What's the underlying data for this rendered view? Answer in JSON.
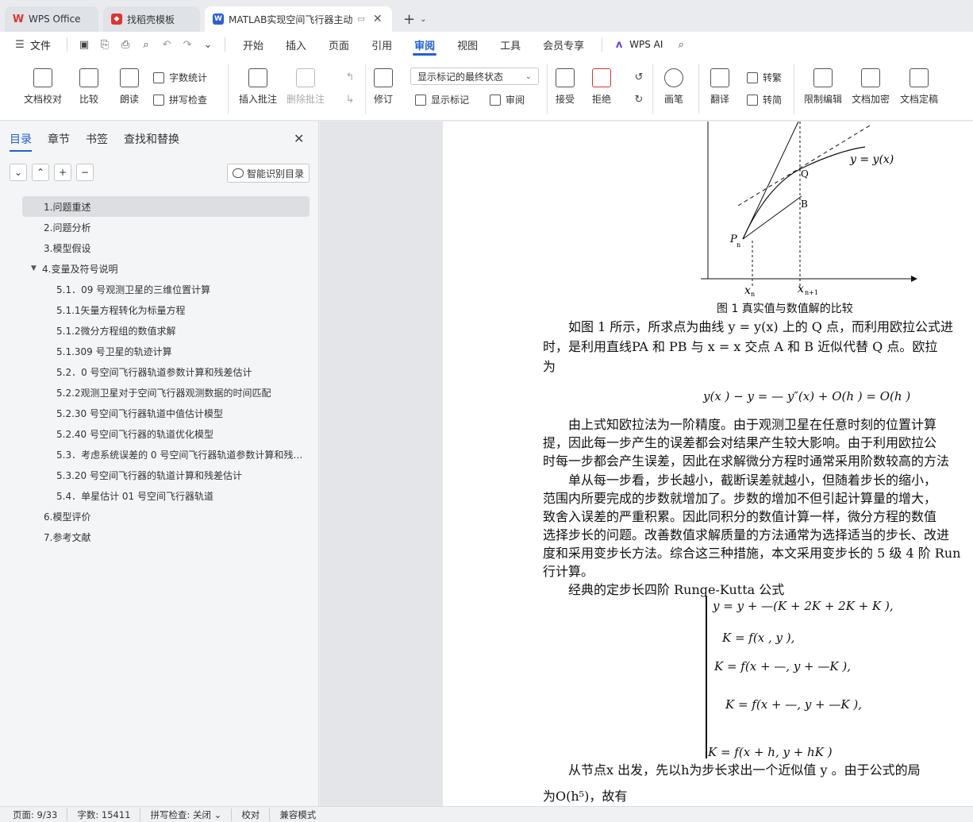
{
  "tabs": [
    {
      "label": "WPS Office",
      "icon": "wps-logo-icon"
    },
    {
      "label": "找稻壳模板",
      "icon": "docer-icon"
    },
    {
      "label": "MATLAB实现空间飞行器主动",
      "icon": "writer-icon",
      "active": true
    }
  ],
  "menu": {
    "file": "文件",
    "items": [
      "开始",
      "插入",
      "页面",
      "引用",
      "审阅",
      "视图",
      "工具",
      "会员专享"
    ],
    "active": "审阅",
    "ai": "WPS AI"
  },
  "ribbon": {
    "doc_check": "文档校对",
    "compare": "比较",
    "read_aloud": "朗读",
    "word_count": "字数统计",
    "spell_check": "拼写检查",
    "insert_comment": "插入批注",
    "delete_comment": "删除批注",
    "revise": "修订",
    "show_mode": "显示标记的最终状态",
    "show_marks": "显示标记",
    "review": "审阅",
    "accept": "接受",
    "reject": "拒绝",
    "pen": "画笔",
    "translate": "翻译",
    "to_traditional": "转繁",
    "to_simplified": "转简",
    "restrict_edit": "限制编辑",
    "encrypt": "文档加密",
    "finalize": "文档定稿"
  },
  "left_panel": {
    "tabs": [
      "目录",
      "章节",
      "书签",
      "查找和替换"
    ],
    "active_tab": "目录",
    "smart_toc": "智能识别目录",
    "toc": [
      {
        "label": "1.问题重述",
        "level": 1,
        "selected": true
      },
      {
        "label": "2.问题分析",
        "level": 1
      },
      {
        "label": "3.模型假设",
        "level": 1
      },
      {
        "label": "4.变量及符号说明",
        "level": 1,
        "expanded": true
      },
      {
        "label": "5.1．09 号观测卫星的三维位置计算",
        "level": 2
      },
      {
        "label": "5.1.1矢量方程转化为标量方程",
        "level": 2
      },
      {
        "label": "5.1.2微分方程组的数值求解",
        "level": 2
      },
      {
        "label": "5.1.309 号卫星的轨迹计算",
        "level": 2
      },
      {
        "label": "5.2．0 号空间飞行器轨道参数计算和残差估计",
        "level": 2
      },
      {
        "label": "5.2.2观测卫星对于空间飞行器观测数据的时间匹配",
        "level": 2
      },
      {
        "label": "5.2.30 号空间飞行器轨道中值估计模型",
        "level": 2
      },
      {
        "label": "5.2.40 号空间飞行器的轨道优化模型",
        "level": 2
      },
      {
        "label": "5.3．考虑系统误差的 0 号空间飞行器轨道参数计算和残差估计",
        "level": 2
      },
      {
        "label": "5.3.20 号空间飞行器的轨道计算和残差估计",
        "level": 2
      },
      {
        "label": "5.4．单星估计 01 号空间飞行器轨道",
        "level": 2
      },
      {
        "label": "6.模型评价",
        "level": 1
      },
      {
        "label": "7.参考文献",
        "level": 1
      }
    ]
  },
  "document": {
    "figure": {
      "curve_label": "y = y(x)",
      "point_q": "Q",
      "point_b": "B",
      "point_p": "P",
      "point_p_sub": "n",
      "x_n": "x",
      "x_n_sub": "n",
      "x_n1": "x",
      "x_n1_sub": "n+1",
      "caption": "图 1 真实值与数值解的比较"
    },
    "para1_line1": "如图 1 所示，所求点为曲线  y = y(x) 上的 Q 点，而利用欧拉公式进",
    "para1_line2": "时，是利用直线PA 和 PB 与 x = x  交点 A 和 B 近似代替 Q 点。欧拉",
    "para1_line3": "为",
    "formula_error": "y(x   ) − y    =  — y″(x) + O(h ) = O(h )",
    "para2_line1": "由上式知欧拉法为一阶精度。由于观测卫星在任意时刻的位置计算",
    "para2_line2": "提，因此每一步产生的误差都会对结果产生较大影响。由于利用欧拉公",
    "para2_line3": "时每一步都会产生误差，因此在求解微分方程时通常采用阶数较高的方法",
    "para3_line1": "单从每一步看，步长越小，截断误差就越小，但随着步长的缩小，",
    "para3_line2": "范围内所要完成的步数就增加了。步数的增加不但引起计算量的增大，",
    "para3_line3": "致舍入误差的严重积累。因此同积分的数值计算一样，微分方程的数值",
    "para3_line4": "选择步长的问题。改善数值求解质量的方法通常为选择适当的步长、改进",
    "para3_line5": "度和采用变步长方法。综合这三种措施，本文采用变步长的 5 级 4 阶 Run",
    "para3_line6": "行计算。",
    "rk_intro": "经典的定步长四阶  Runge-Kutta 公式",
    "rk_lines": [
      "y     = y + —(K + 2K + 2K + K ),",
      "K  =  f(x , y ),",
      "K  = f(x + —, y + —K ),",
      "K  =  f(x + —, y + —K ),",
      "K  = f(x + h, y + hK )"
    ],
    "para4_line1": "从节点x 出发，先以h为步长求出一个近似值  y       。由于公式的局",
    "para4_line2": "为O(h⁵)，故有"
  },
  "status": {
    "page": "页面: 9/33",
    "words": "字数: 15411",
    "spell": "拼写检查: 关闭",
    "proof": "校对",
    "compat": "兼容模式"
  }
}
